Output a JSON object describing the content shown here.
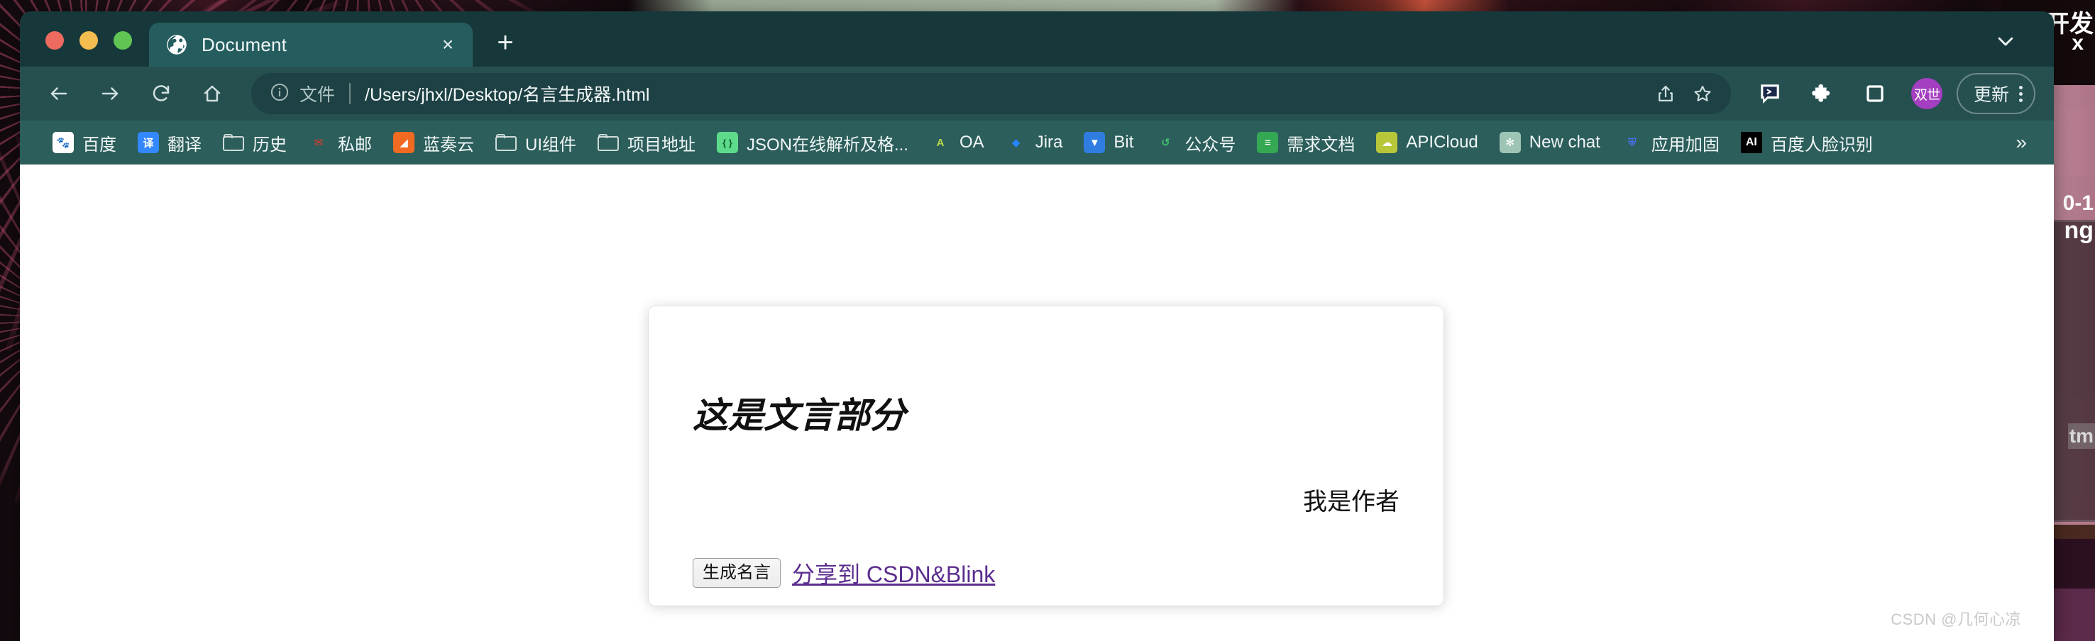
{
  "desktop": {
    "fragments": [
      {
        "id": "bg-kaifa",
        "text": "开发"
      },
      {
        "id": "bg-x",
        "text": "x"
      },
      {
        "id": "bg-num",
        "text": "0-1"
      },
      {
        "id": "bg-ng",
        "text": "ng"
      },
      {
        "id": "bg-tm",
        "text": "tm"
      }
    ]
  },
  "window": {
    "traffic_lights": [
      "close",
      "minimize",
      "maximize"
    ]
  },
  "tabstrip": {
    "tab": {
      "title": "Document",
      "favicon": "globe-icon",
      "close_label": "×"
    },
    "new_tab_label": "+",
    "tab_list_icon": "chevron-down-icon"
  },
  "toolbar": {
    "back_icon": "back-arrow-icon",
    "forward_icon": "forward-arrow-icon",
    "reload_icon": "reload-icon",
    "home_icon": "home-icon",
    "omnibox": {
      "info_icon": "info-circle-icon",
      "scheme_label": "文件",
      "url": "/Users/jhxl/Desktop/名言生成器.html",
      "share_icon": "share-icon",
      "bookmark_icon": "star-icon"
    },
    "extensions": [
      {
        "name": "chat-extension-icon",
        "label": ""
      },
      {
        "name": "puzzle-icon",
        "label": ""
      },
      {
        "name": "side-panel-icon",
        "label": ""
      }
    ],
    "avatar_label": "双世",
    "update_label": "更新",
    "menu_icon": "kebab-menu-icon"
  },
  "bookmarks": {
    "items": [
      {
        "label": "百度",
        "icon": "baidu-paw-icon",
        "icon_bg": "#ffffff",
        "icon_fg": "#2f6fd0",
        "glyph": "🐾"
      },
      {
        "label": "翻译",
        "icon": "translate-icon",
        "icon_bg": "#3388ff",
        "icon_fg": "#ffffff",
        "glyph": "译"
      },
      {
        "label": "历史",
        "icon": "folder-icon",
        "icon_bg": "",
        "icon_fg": "",
        "glyph": ""
      },
      {
        "label": "私邮",
        "icon": "mail-icon",
        "icon_bg": "#2c5e5b",
        "icon_fg": "#e23b2e",
        "glyph": "✉"
      },
      {
        "label": "蓝奏云",
        "icon": "lanzou-icon",
        "icon_bg": "#f06a21",
        "icon_fg": "#ffffff",
        "glyph": "◢"
      },
      {
        "label": "UI组件",
        "icon": "folder-icon",
        "icon_bg": "",
        "icon_fg": "",
        "glyph": ""
      },
      {
        "label": "项目地址",
        "icon": "folder-icon",
        "icon_bg": "",
        "icon_fg": "",
        "glyph": ""
      },
      {
        "label": "JSON在线解析及格...",
        "icon": "json-icon",
        "icon_bg": "#5ddb8a",
        "icon_fg": "#0b5b2c",
        "glyph": "{ }"
      },
      {
        "label": "OA",
        "icon": "oa-icon",
        "icon_bg": "#2c5e5b",
        "icon_fg": "#b9d54a",
        "glyph": "A"
      },
      {
        "label": "Jira",
        "icon": "jira-icon",
        "icon_bg": "#2c5e5b",
        "icon_fg": "#2684ff",
        "glyph": "◆"
      },
      {
        "label": "Bit",
        "icon": "bit-icon",
        "icon_bg": "#2f7de1",
        "icon_fg": "#ffffff",
        "glyph": "▼"
      },
      {
        "label": "公众号",
        "icon": "wechat-mp-icon",
        "icon_bg": "#2c5e5b",
        "icon_fg": "#3fc06a",
        "glyph": "↺"
      },
      {
        "label": "需求文档",
        "icon": "sheets-icon",
        "icon_bg": "#34a853",
        "icon_fg": "#ffffff",
        "glyph": "≡"
      },
      {
        "label": "APICloud",
        "icon": "apicloud-icon",
        "icon_bg": "#b8c63a",
        "icon_fg": "#ffffff",
        "glyph": "☁"
      },
      {
        "label": "New chat",
        "icon": "openai-icon",
        "icon_bg": "#9dc4b4",
        "icon_fg": "#ffffff",
        "glyph": "✻"
      },
      {
        "label": "应用加固",
        "icon": "shield-check-icon",
        "icon_bg": "#2c5e5b",
        "icon_fg": "#4a6ef0",
        "glyph": "⛨"
      },
      {
        "label": "百度人脸识别",
        "icon": "ai-icon",
        "icon_bg": "#000000",
        "icon_fg": "#ffffff",
        "glyph": "AI"
      }
    ],
    "overflow_label": "»"
  },
  "page": {
    "quote_text": "这是文言部分",
    "author_text": "我是作者",
    "generate_button_label": "生成名言",
    "share_link_label": "分享到 CSDN&Blink",
    "watermark": "CSDN @几何心凉"
  },
  "colors": {
    "tabstrip_bg": "#17383b",
    "tab_active_bg": "#255d5f",
    "toolbar_bg": "#264f50",
    "omnibox_bg": "#1d4144",
    "bookmarks_bg": "#2c5e5b",
    "page_bg": "#ffffff",
    "link_visited": "#5b2d8e",
    "avatar_bg": "#a33fc0"
  }
}
